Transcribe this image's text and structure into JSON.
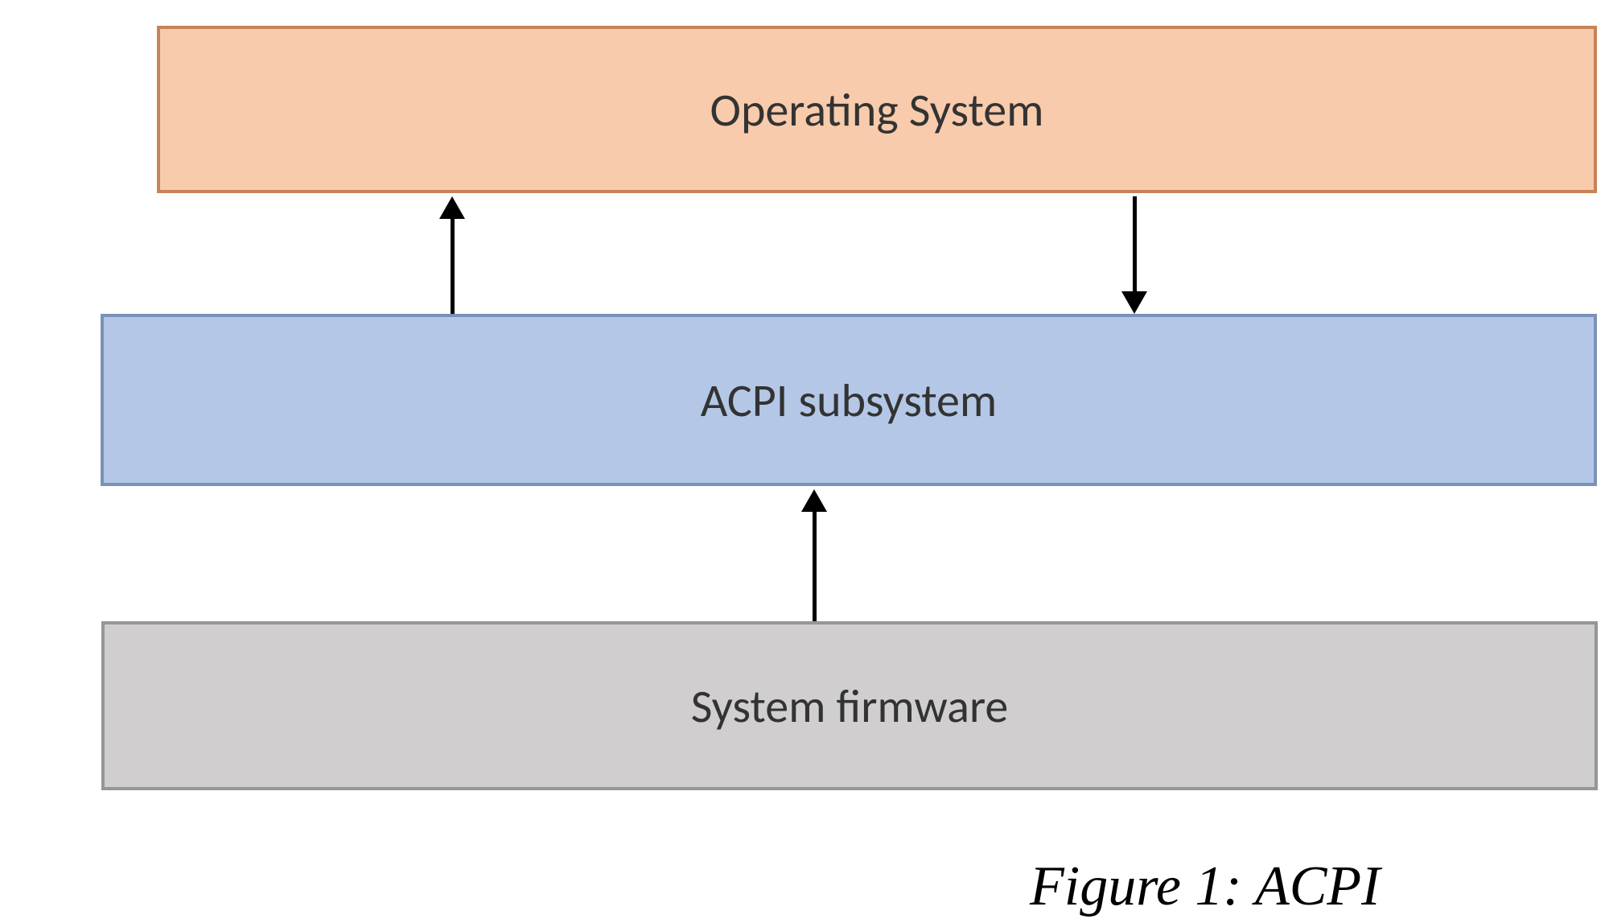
{
  "boxes": {
    "os": {
      "label": "Operating System"
    },
    "acpi": {
      "label": "ACPI subsystem"
    },
    "firmware": {
      "label": "System firmware"
    }
  },
  "caption": "Figure 1: ACPI"
}
